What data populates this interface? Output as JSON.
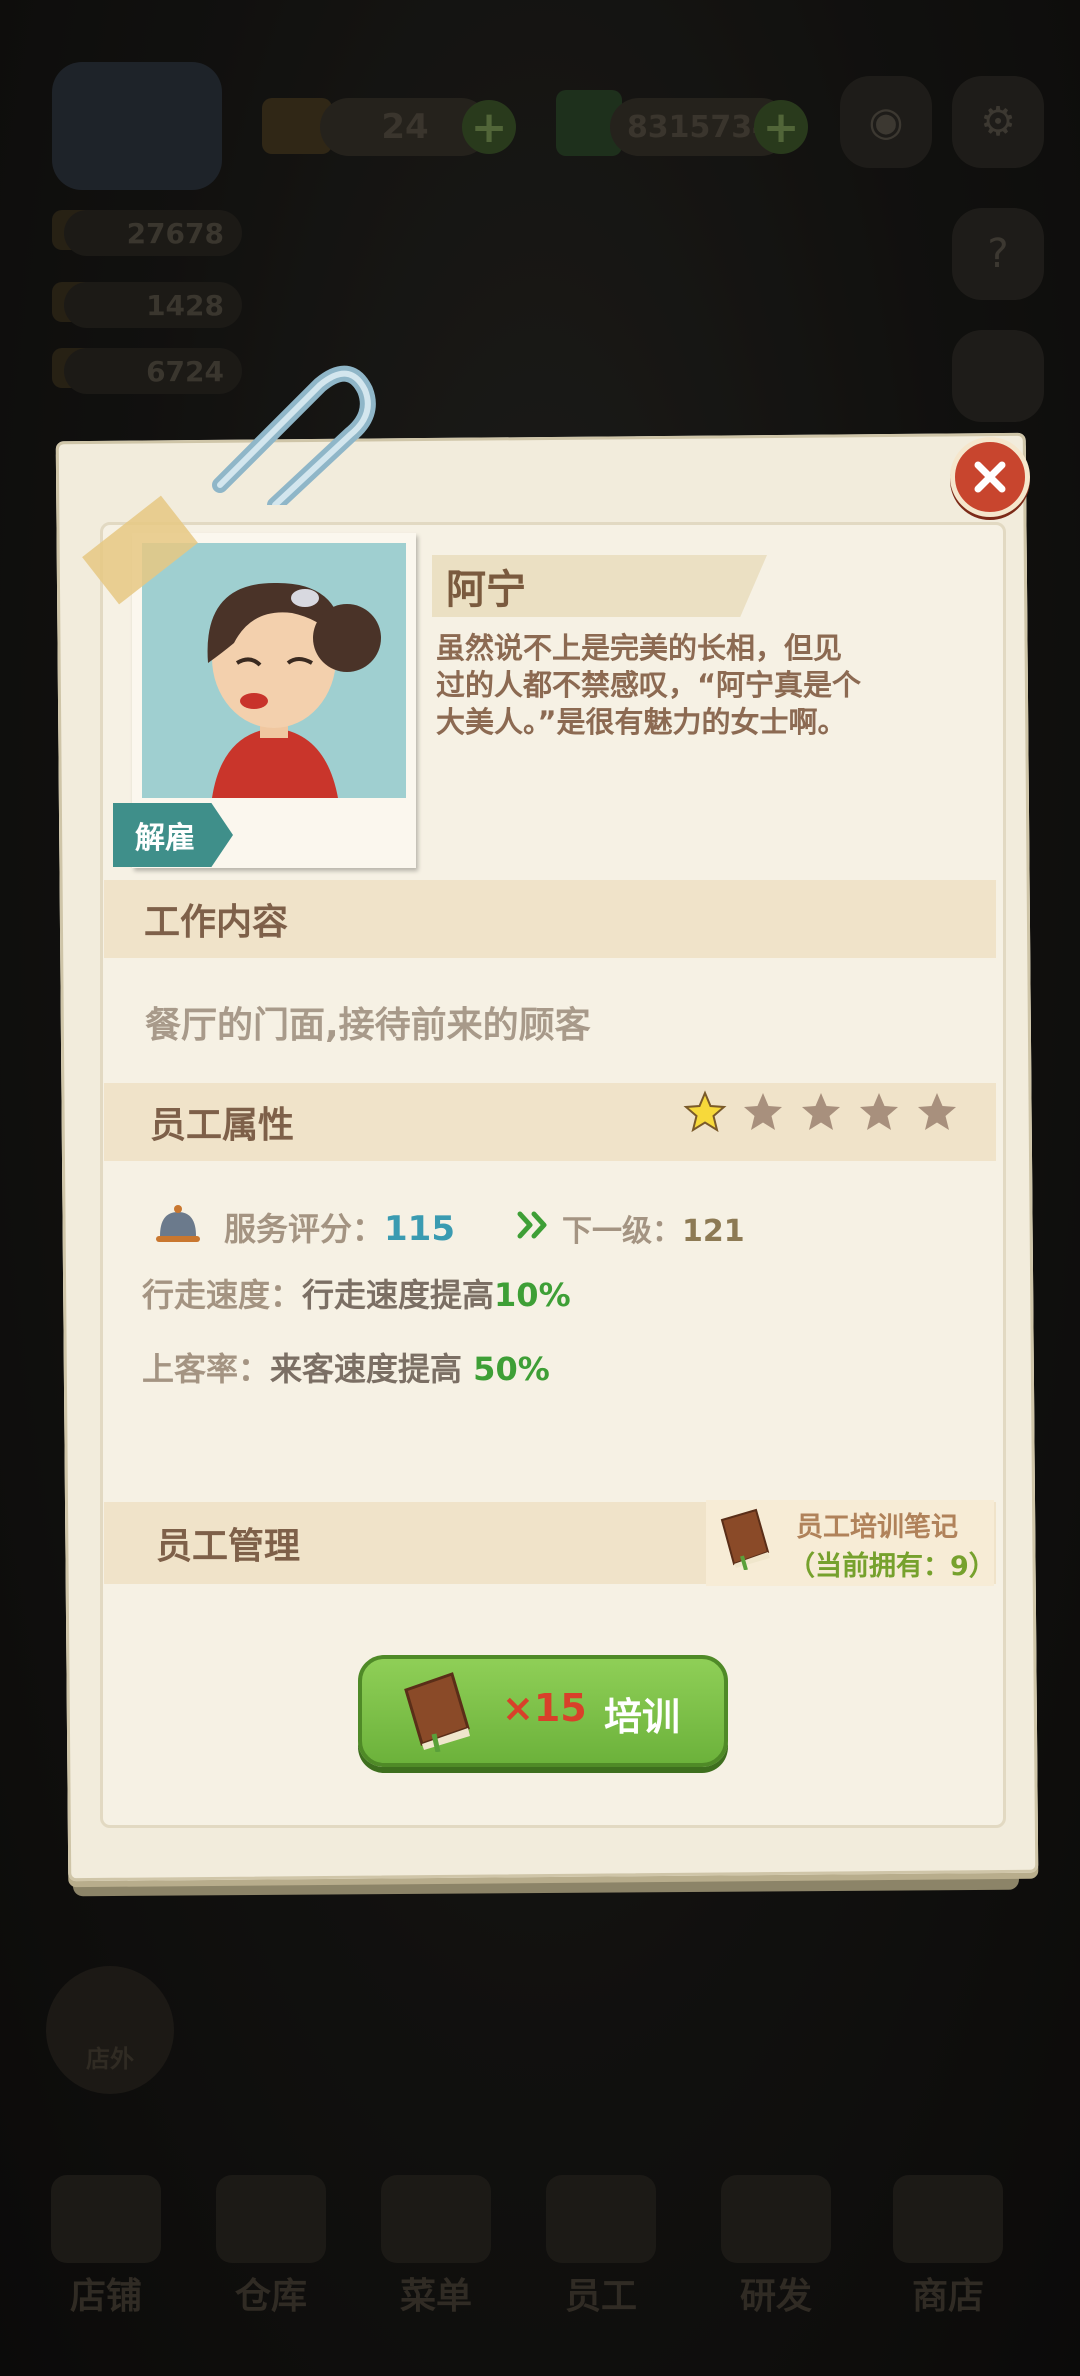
{
  "hud": {
    "gems": "24",
    "cash": "8315734",
    "resources": [
      "27678",
      "1428",
      "6724"
    ]
  },
  "employee": {
    "name": "阿宁",
    "description": "虽然说不上是完美的长相，但见过的人都不禁感叹，“阿宁真是个大美人。”是很有魅力的女士啊。",
    "fire_label": "解雇"
  },
  "sections": {
    "work_title": "工作内容",
    "work_desc": "餐厅的门面,接待前来的顾客",
    "attr_title": "员工属性",
    "manage_title": "员工管理"
  },
  "stars": {
    "filled": 1,
    "total": 5
  },
  "attributes": {
    "service_label": "服务评分：",
    "service_value": "115",
    "next_label": "下一级：",
    "next_value": "121",
    "walk_label": "行走速度：",
    "walk_text": "行走速度提高",
    "walk_value": "10%",
    "customer_label": "上客率：",
    "customer_text": "来客速度提高 ",
    "customer_value": "50%"
  },
  "notes": {
    "title": "员工培训笔记",
    "count": "（当前拥有：9）"
  },
  "train": {
    "count": "×15",
    "label": "培训"
  },
  "outside_label": "店外",
  "nav": [
    "店铺",
    "仓库",
    "菜单",
    "员工",
    "研发",
    "商店"
  ],
  "colors": {
    "paper": "#f2ecdc",
    "section": "#f0e3c9",
    "train_button": "#7bbf46",
    "close_button": "#c8452e",
    "teal_tag": "#3f8f8a"
  }
}
